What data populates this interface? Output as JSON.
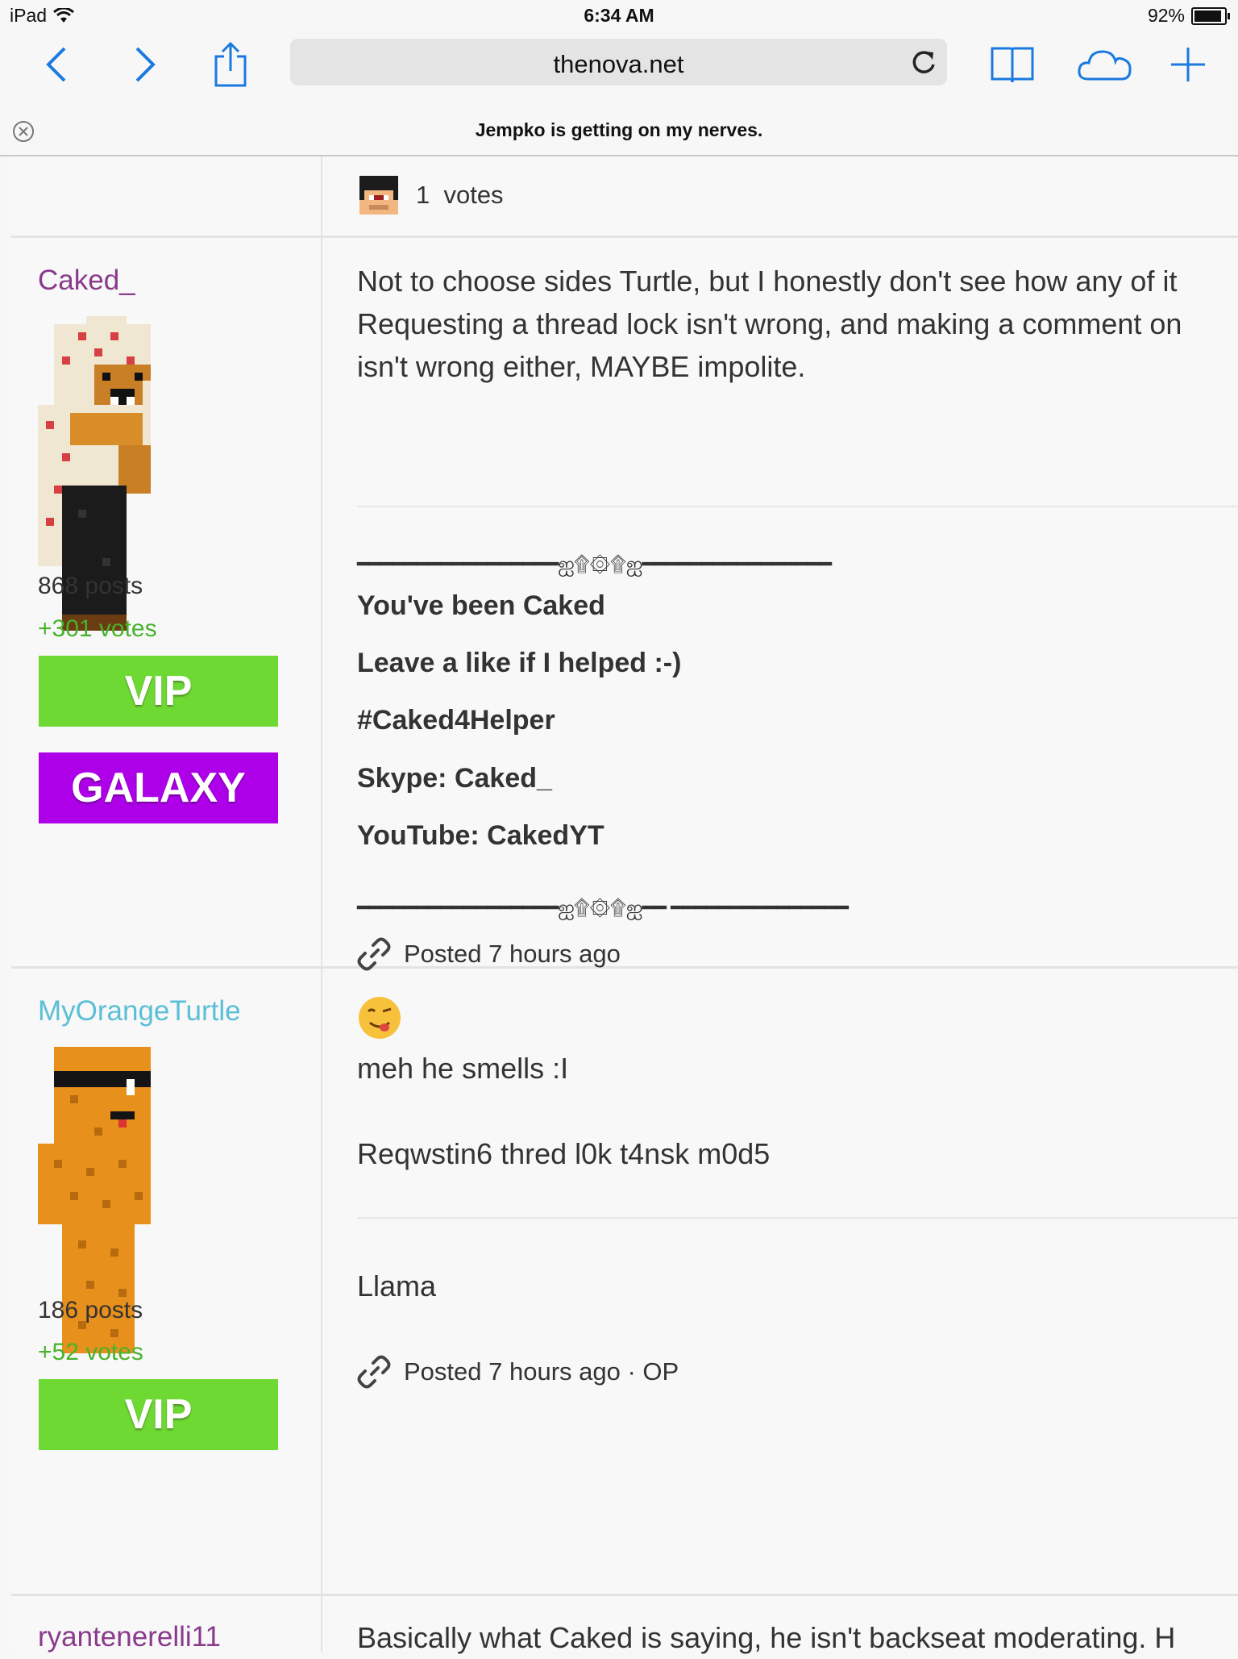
{
  "status_bar": {
    "device": "iPad",
    "time": "6:34 AM",
    "battery": "92%",
    "battery_level": 0.92
  },
  "browser": {
    "url": "thenova.net",
    "page_title": "Jempko is getting on my nerves."
  },
  "top_votes": {
    "count_label": "1  votes"
  },
  "posts": [
    {
      "author": "Caked_",
      "author_color": "#8a3a8c",
      "post_count": "868 posts",
      "votes": "+301 votes",
      "badges": [
        "VIP",
        "GALAXY"
      ],
      "body_lines": [
        "Not to choose sides Turtle, but I honestly don't see how any of it",
        "Requesting a thread lock isn't wrong, and making a comment on",
        "isn't wrong either, MAYBE impolite."
      ],
      "sig_divider": "━━━━━━━━━━━━━━━━━ஐ۩۞۩ஐ━━━━━━━━━━━━━━━━",
      "sig_divider_bottom": "━━━━━━━━━━━━━━━━━ஐ۩۞۩ஐ━━ ━━━━━━━━━━━━━━━",
      "signature": [
        "You've been Caked",
        "Leave a like if I helped :-)",
        "#Caked4Helper",
        "Skype: Caked_",
        "YouTube: CakedYT"
      ],
      "posted": "Posted 7 hours ago"
    },
    {
      "author": "MyOrangeTurtle",
      "author_color": "#5bbfd6",
      "post_count": "186 posts",
      "votes": "+52 votes",
      "badges": [
        "VIP"
      ],
      "body_lines": [
        "meh he smells :I",
        "",
        "Reqwstin6 thred l0k t4nsk m0d5"
      ],
      "signature_line": "Llama",
      "posted": "Posted 7 hours ago · OP"
    },
    {
      "author": "ryantenerelli11",
      "author_color": "#8a3a8c",
      "body_lines": [
        "Basically what Caked is saying, he isn't backseat moderating. H"
      ]
    }
  ],
  "icons": [
    "wifi-icon",
    "back-icon",
    "forward-icon",
    "share-icon",
    "reload-icon",
    "bookmarks-icon",
    "cloud-tabs-icon",
    "new-tab-icon",
    "close-tab-icon",
    "link-icon",
    "emoji-icon"
  ]
}
